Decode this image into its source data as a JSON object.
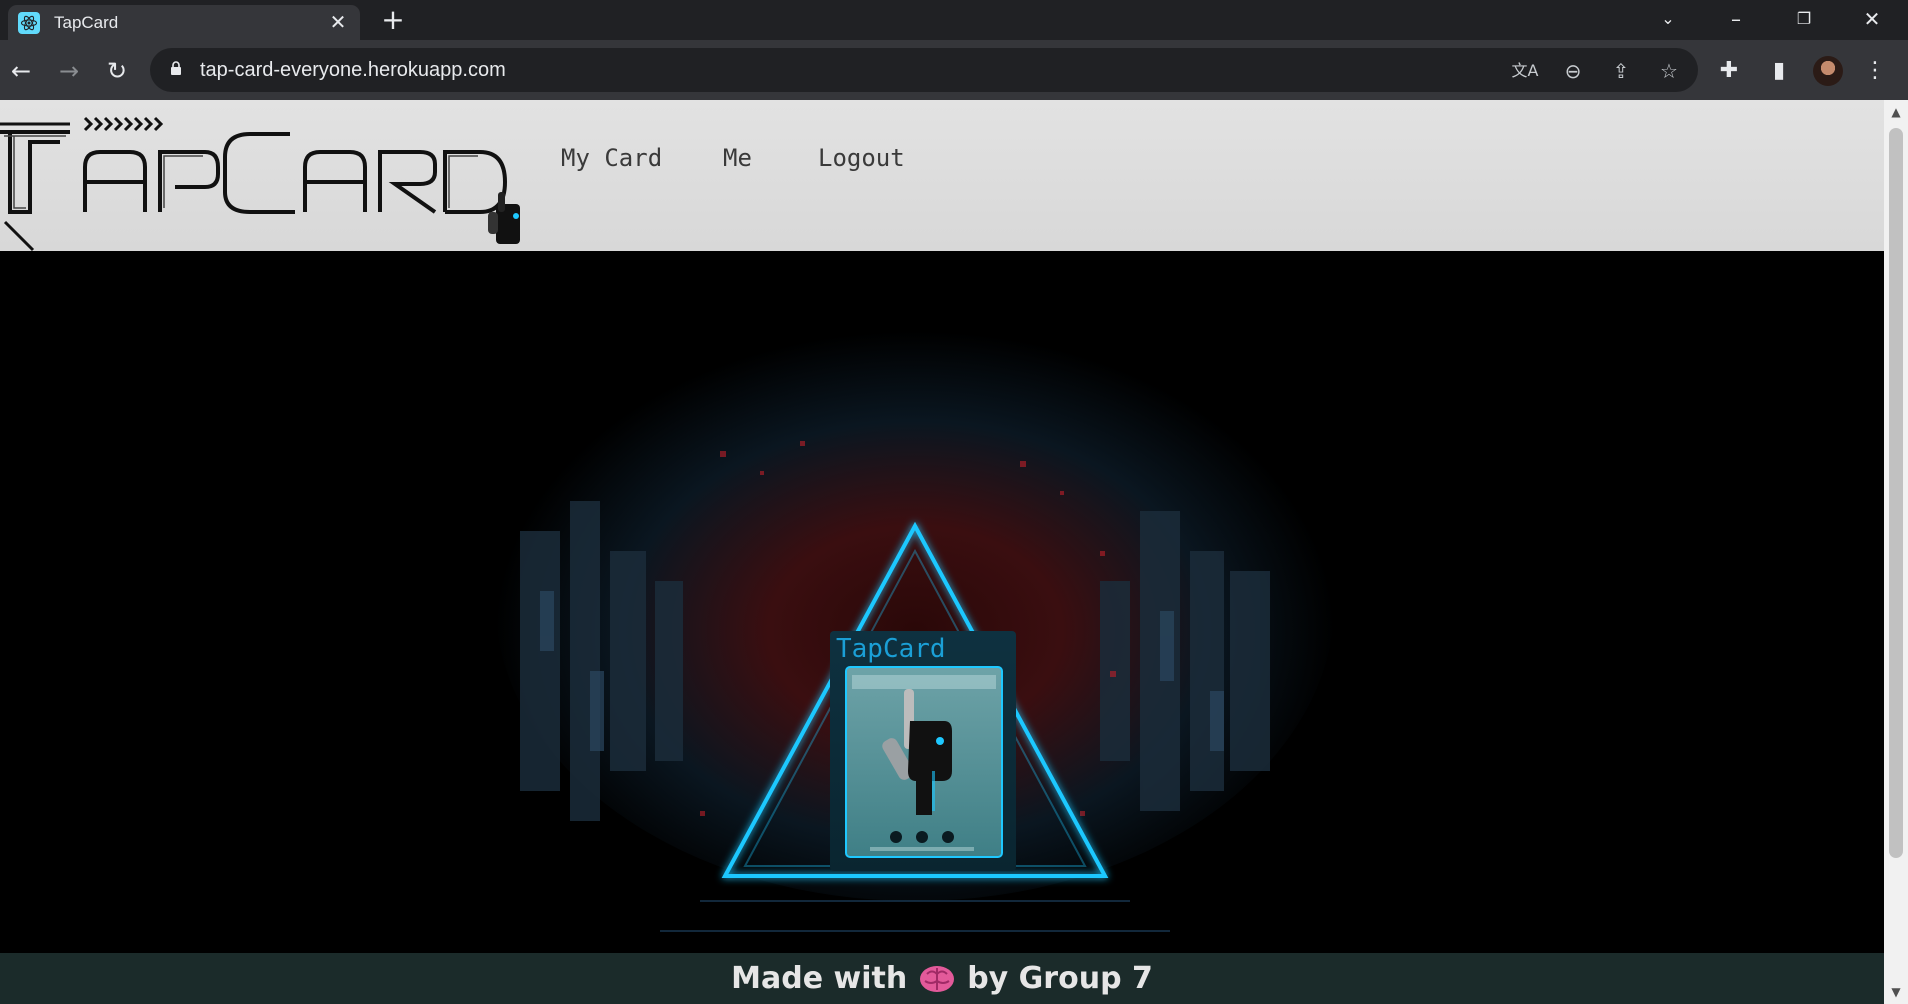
{
  "browser": {
    "tab_title": "TapCard",
    "url": "tap-card-everyone.herokuapp.com",
    "icons": [
      "react-favicon",
      "close-icon",
      "plus-icon",
      "chevron-down-icon",
      "minimize-icon",
      "restore-icon",
      "window-close-icon",
      "back-icon",
      "forward-icon",
      "reload-icon",
      "lock-icon",
      "translate-icon",
      "zoom-out-icon",
      "share-icon",
      "star-icon",
      "extensions-icon",
      "sidepanel-icon",
      "avatar",
      "menu-icon"
    ]
  },
  "site": {
    "logo_text": "TapCard",
    "nav": [
      {
        "label": "My Card"
      },
      {
        "label": "Me"
      },
      {
        "label": "Logout"
      }
    ],
    "hero": {
      "card_logo_text": "TapCard",
      "accent_color": "#1ec8ff",
      "background_color": "#000000"
    },
    "footer": {
      "prefix": "Made with",
      "emoji_icon": "brain-icon",
      "suffix": "by Group 7"
    }
  }
}
